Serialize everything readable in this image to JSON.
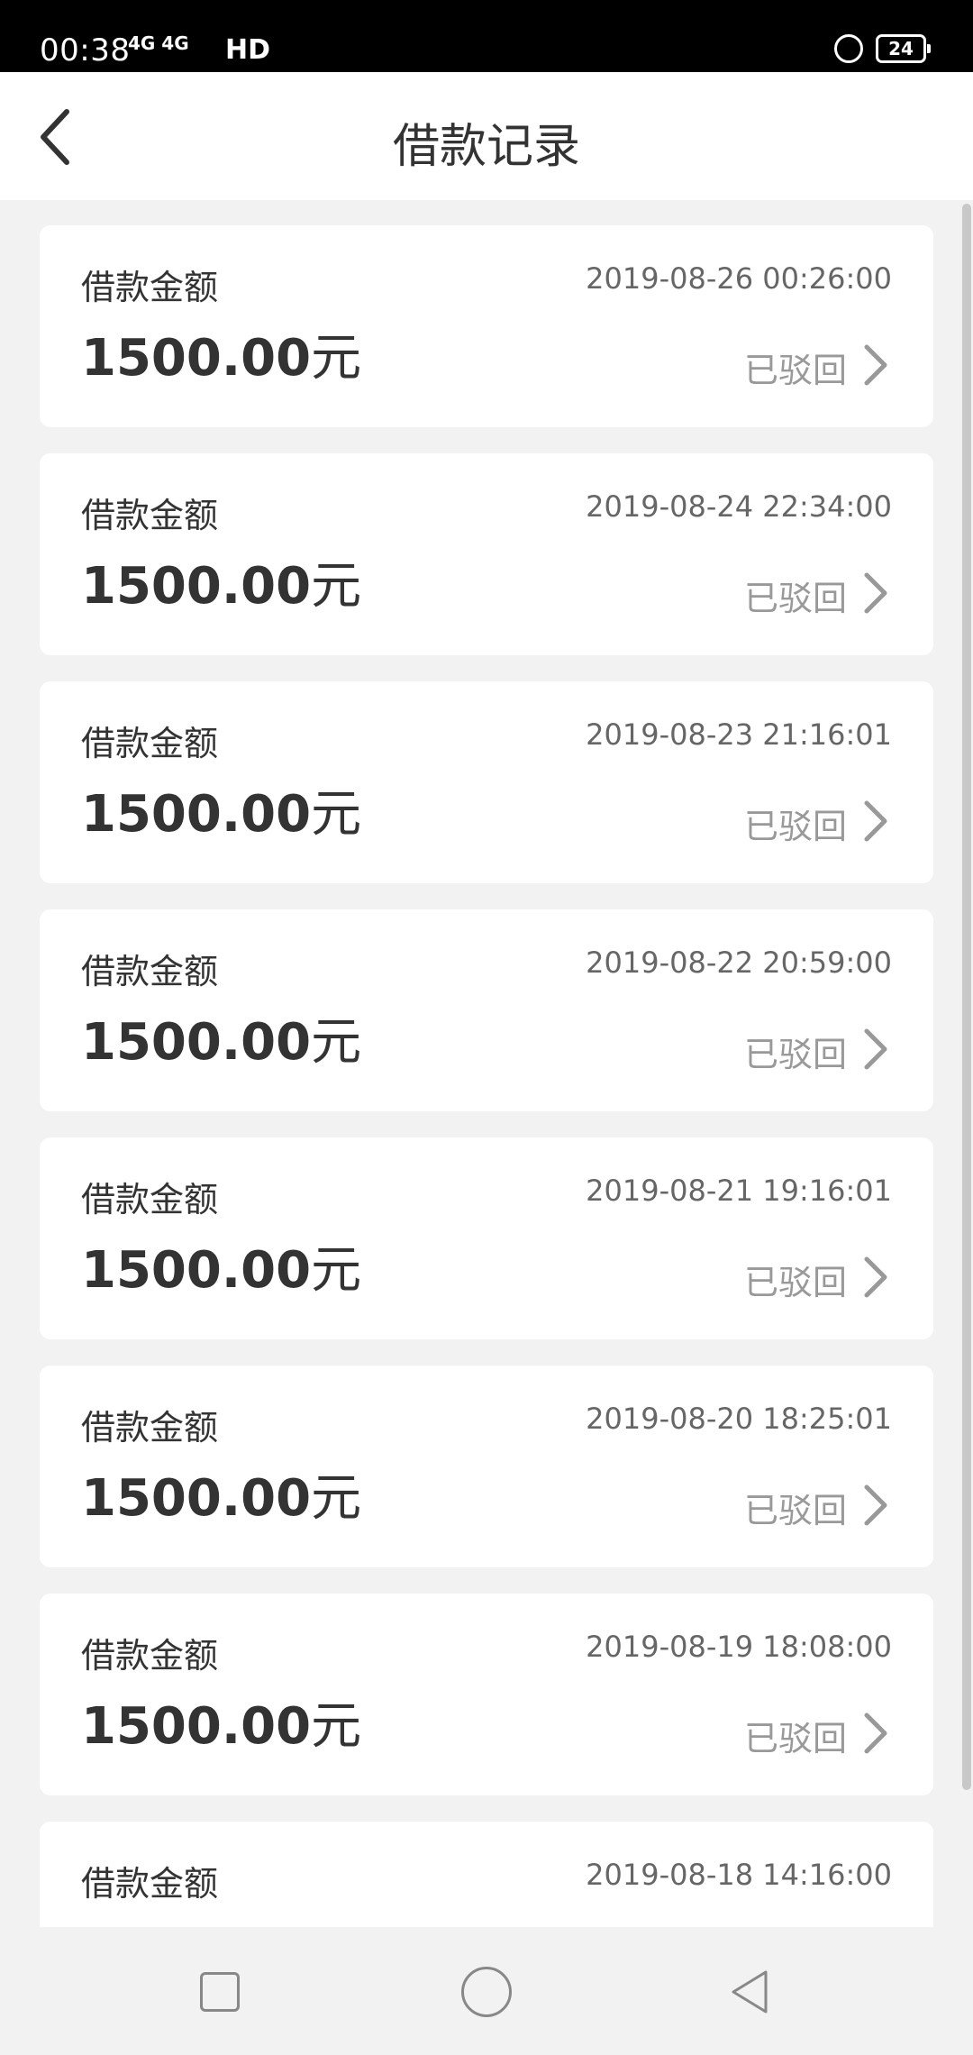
{
  "status_bar": {
    "time": "00:38",
    "signal": "4G 4G",
    "hd": "HD",
    "battery": "24"
  },
  "header": {
    "title": "借款记录"
  },
  "records": [
    {
      "label": "借款金额",
      "date": "2019-08-26 00:26:00",
      "amount": "1500.00",
      "unit": "元",
      "status": "已驳回"
    },
    {
      "label": "借款金额",
      "date": "2019-08-24 22:34:00",
      "amount": "1500.00",
      "unit": "元",
      "status": "已驳回"
    },
    {
      "label": "借款金额",
      "date": "2019-08-23 21:16:01",
      "amount": "1500.00",
      "unit": "元",
      "status": "已驳回"
    },
    {
      "label": "借款金额",
      "date": "2019-08-22 20:59:00",
      "amount": "1500.00",
      "unit": "元",
      "status": "已驳回"
    },
    {
      "label": "借款金额",
      "date": "2019-08-21 19:16:01",
      "amount": "1500.00",
      "unit": "元",
      "status": "已驳回"
    },
    {
      "label": "借款金额",
      "date": "2019-08-20 18:25:01",
      "amount": "1500.00",
      "unit": "元",
      "status": "已驳回"
    },
    {
      "label": "借款金额",
      "date": "2019-08-19 18:08:00",
      "amount": "1500.00",
      "unit": "元",
      "status": "已驳回"
    },
    {
      "label": "借款金额",
      "date": "2019-08-18 14:16:00",
      "amount": "",
      "unit": "",
      "status": ""
    }
  ],
  "icons": {
    "back": "back-arrow-icon",
    "chevron": "chevron-right-icon",
    "nav_recent": "square-icon",
    "nav_home": "circle-icon",
    "nav_back": "triangle-back-icon"
  }
}
